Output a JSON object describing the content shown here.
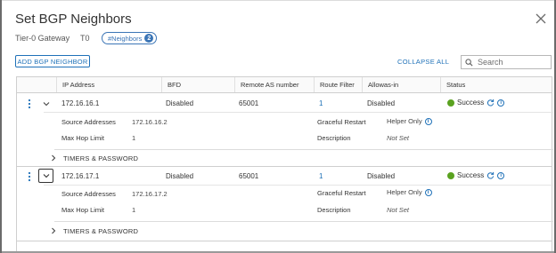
{
  "dialog": {
    "title": "Set BGP Neighbors",
    "gateway_label": "Tier-0 Gateway",
    "gateway_value": "T0",
    "badge_label": "#Neighbors",
    "badge_count": "2"
  },
  "toolbar": {
    "add_label": "ADD BGP NEIGHBOR",
    "collapse_label": "COLLAPSE ALL",
    "search_placeholder": "Search"
  },
  "table": {
    "columns": [
      "IP Address",
      "BFD",
      "Remote AS number",
      "Route Filter",
      "Allowas-in",
      "Status"
    ],
    "rows": [
      {
        "ip": "172.16.16.1",
        "bfd": "Disabled",
        "remote_as": "65001",
        "route_filter": "1",
        "allowas_in": "Disabled",
        "status": "Success",
        "details": {
          "source_label": "Source Addresses",
          "source_value": "172.16.16.2",
          "maxhop_label": "Max Hop Limit",
          "maxhop_value": "1",
          "graceful_label": "Graceful Restart",
          "graceful_value": "Helper Only",
          "desc_label": "Description",
          "desc_value": "Not Set"
        },
        "timers_label": "TIMERS & PASSWORD"
      },
      {
        "ip": "172.16.17.1",
        "bfd": "Disabled",
        "remote_as": "65001",
        "route_filter": "1",
        "allowas_in": "Disabled",
        "status": "Success",
        "details": {
          "source_label": "Source Addresses",
          "source_value": "172.16.17.2",
          "maxhop_label": "Max Hop Limit",
          "maxhop_value": "1",
          "graceful_label": "Graceful Restart",
          "graceful_value": "Helper Only",
          "desc_label": "Description",
          "desc_value": "Not Set"
        },
        "timers_label": "TIMERS & PASSWORD"
      }
    ]
  },
  "colors": {
    "accent": "#1f71b8",
    "success": "#5aa220"
  },
  "icons": [
    "close-icon",
    "search-icon",
    "kebab-menu-icon",
    "chevron-down-icon",
    "chevron-right-icon",
    "success-status-icon",
    "refresh-icon",
    "info-icon"
  ]
}
